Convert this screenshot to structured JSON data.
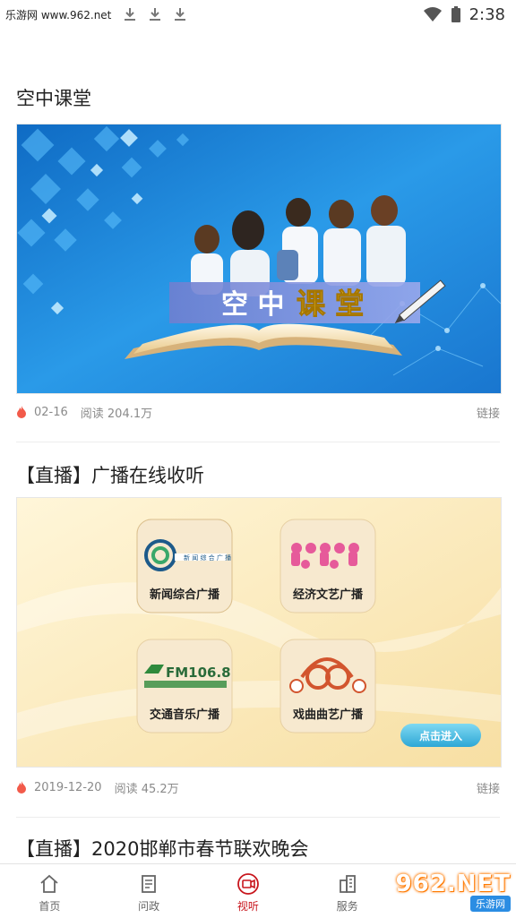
{
  "status_bar": {
    "watermark": "乐游网 www.962.net",
    "time": "2:38"
  },
  "feed": [
    {
      "title": "空中课堂",
      "banner_text_1": "空 中 ",
      "banner_text_2": "课 堂",
      "date": "02-16",
      "reads": "阅读 204.1万",
      "link": "链接"
    },
    {
      "title": "【直播】广播在线收听",
      "stations": [
        {
          "name": "新闻综合广播",
          "logo_text": "新 闻 综 合 广 播"
        },
        {
          "name": "经济文艺广播",
          "logo_text": ""
        },
        {
          "name": "交通音乐广播",
          "logo_text": "FM106.8"
        },
        {
          "name": "戏曲曲艺广播",
          "logo_text": "1003"
        }
      ],
      "enter_button": "点击进入",
      "date": "2019-12-20",
      "reads": "阅读 45.2万",
      "link": "链接"
    },
    {
      "title": "【直播】2020邯郸市春节联欢晚会"
    }
  ],
  "tabs": [
    {
      "label": "首页",
      "icon": "home-icon"
    },
    {
      "label": "问政",
      "icon": "document-icon"
    },
    {
      "label": "视听",
      "icon": "video-icon"
    },
    {
      "label": "服务",
      "icon": "building-icon"
    }
  ],
  "active_tab": "视听",
  "bottom_watermark": {
    "logo": "962.NET",
    "sub": "乐游网"
  },
  "colors": {
    "accent": "#c8161d",
    "banner_blue": "#1b86d6"
  }
}
